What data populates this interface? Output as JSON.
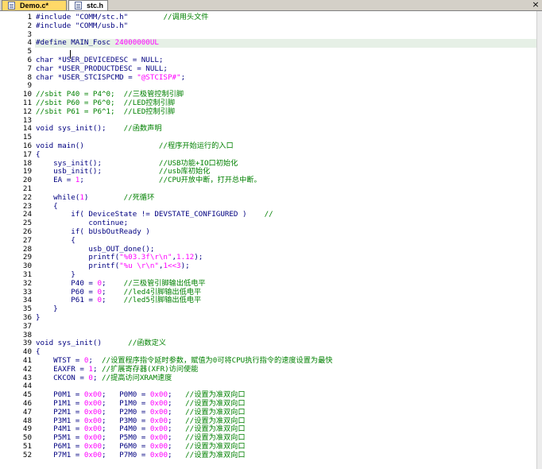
{
  "tabs": [
    {
      "label": "Demo.c*",
      "active": false
    },
    {
      "label": "stc.h",
      "active": true
    }
  ],
  "close_glyph": "×",
  "lines": [
    {
      "n": "1",
      "parts": [
        [
          "t",
          "#include \"COMM/stc.h\""
        ],
        [
          "s",
          "        "
        ],
        [
          "c",
          "//调用头文件"
        ]
      ]
    },
    {
      "n": "2",
      "parts": [
        [
          "t",
          "#include \"COMM/usb.h\""
        ]
      ]
    },
    {
      "n": "3",
      "parts": []
    },
    {
      "n": "4",
      "parts": [
        [
          "t",
          "#define MAIN_Fosc "
        ],
        [
          "n",
          "24000000UL"
        ]
      ]
    },
    {
      "n": "5",
      "parts": []
    },
    {
      "n": "6",
      "parts": [
        [
          "t",
          "char *USER_DEVICEDESC = NULL;"
        ]
      ]
    },
    {
      "n": "7",
      "parts": [
        [
          "t",
          "char *USER_PRODUCTDESC = NULL;"
        ]
      ]
    },
    {
      "n": "8",
      "parts": [
        [
          "t",
          "char *USER_STCISPCMD = "
        ],
        [
          "n",
          "\"@STCISP#\""
        ],
        [
          "t",
          ";"
        ]
      ]
    },
    {
      "n": "9",
      "parts": []
    },
    {
      "n": "10",
      "parts": [
        [
          "c",
          "//sbit P40 = P4^0;  //三极管控制引脚"
        ]
      ]
    },
    {
      "n": "11",
      "parts": [
        [
          "c",
          "//sbit P60 = P6^0;  //LED控制引脚"
        ]
      ]
    },
    {
      "n": "12",
      "parts": [
        [
          "c",
          "//sbit P61 = P6^1;  //LED控制引脚"
        ]
      ]
    },
    {
      "n": "13",
      "parts": []
    },
    {
      "n": "14",
      "parts": [
        [
          "t",
          "void sys_init();    "
        ],
        [
          "c",
          "//函数声明"
        ]
      ]
    },
    {
      "n": "15",
      "parts": []
    },
    {
      "n": "16",
      "parts": [
        [
          "t",
          "void main()                 "
        ],
        [
          "c",
          "//程序开始运行的入口"
        ]
      ]
    },
    {
      "n": "17",
      "parts": [
        [
          "t",
          "{"
        ]
      ]
    },
    {
      "n": "18",
      "parts": [
        [
          "t",
          "    sys_init();             "
        ],
        [
          "c",
          "//USB功能+IO口初始化"
        ]
      ]
    },
    {
      "n": "19",
      "parts": [
        [
          "t",
          "    usb_init();             "
        ],
        [
          "c",
          "//usb库初始化"
        ]
      ]
    },
    {
      "n": "20",
      "parts": [
        [
          "t",
          "    EA = "
        ],
        [
          "n",
          "1"
        ],
        [
          "t",
          ";                 "
        ],
        [
          "c",
          "//CPU开放中断，打开总中断。"
        ]
      ]
    },
    {
      "n": "21",
      "parts": []
    },
    {
      "n": "22",
      "parts": [
        [
          "t",
          "    while("
        ],
        [
          "n",
          "1"
        ],
        [
          "t",
          ")        "
        ],
        [
          "c",
          "//死循环"
        ]
      ]
    },
    {
      "n": "23",
      "parts": [
        [
          "t",
          "    {"
        ]
      ]
    },
    {
      "n": "24",
      "parts": [
        [
          "t",
          "        if( DeviceState != DEVSTATE_CONFIGURED )    "
        ],
        [
          "c",
          "//"
        ]
      ]
    },
    {
      "n": "25",
      "parts": [
        [
          "t",
          "            continue;"
        ]
      ]
    },
    {
      "n": "26",
      "parts": [
        [
          "t",
          "        if( bUsbOutReady )"
        ]
      ]
    },
    {
      "n": "27",
      "parts": [
        [
          "t",
          "        {"
        ]
      ]
    },
    {
      "n": "28",
      "parts": [
        [
          "t",
          "            usb_OUT_done();"
        ]
      ]
    },
    {
      "n": "29",
      "parts": [
        [
          "t",
          "            printf("
        ],
        [
          "n",
          "\"%03.3f\\r\\n\""
        ],
        [
          "t",
          ","
        ],
        [
          "n",
          "1.12"
        ],
        [
          "t",
          ");"
        ]
      ]
    },
    {
      "n": "30",
      "parts": [
        [
          "t",
          "            printf("
        ],
        [
          "n",
          "\"%u \\r\\n\""
        ],
        [
          "t",
          ","
        ],
        [
          "n",
          "1<<3"
        ],
        [
          "t",
          ");"
        ]
      ]
    },
    {
      "n": "31",
      "parts": [
        [
          "t",
          "        }"
        ]
      ]
    },
    {
      "n": "32",
      "parts": [
        [
          "t",
          "        P40 = "
        ],
        [
          "n",
          "0"
        ],
        [
          "t",
          ";    "
        ],
        [
          "c",
          "//三极管引脚输出低电平"
        ]
      ]
    },
    {
      "n": "33",
      "parts": [
        [
          "t",
          "        P60 = "
        ],
        [
          "n",
          "0"
        ],
        [
          "t",
          ";    "
        ],
        [
          "c",
          "//led4引脚输出低电平"
        ]
      ]
    },
    {
      "n": "34",
      "parts": [
        [
          "t",
          "        P61 = "
        ],
        [
          "n",
          "0"
        ],
        [
          "t",
          ";    "
        ],
        [
          "c",
          "//led5引脚输出低电平"
        ]
      ]
    },
    {
      "n": "35",
      "parts": [
        [
          "t",
          "    }"
        ]
      ]
    },
    {
      "n": "36",
      "parts": [
        [
          "t",
          "}"
        ]
      ]
    },
    {
      "n": "37",
      "parts": []
    },
    {
      "n": "38",
      "parts": []
    },
    {
      "n": "39",
      "parts": [
        [
          "t",
          "void sys_init()      "
        ],
        [
          "c",
          "//函数定义"
        ]
      ]
    },
    {
      "n": "40",
      "parts": [
        [
          "t",
          "{"
        ]
      ]
    },
    {
      "n": "41",
      "parts": [
        [
          "t",
          "    WTST = "
        ],
        [
          "n",
          "0"
        ],
        [
          "t",
          ";  "
        ],
        [
          "c",
          "//设置程序指令延时参数，赋值为0可将CPU执行指令的速度设置为最快"
        ]
      ]
    },
    {
      "n": "42",
      "parts": [
        [
          "t",
          "    EAXFR = "
        ],
        [
          "n",
          "1"
        ],
        [
          "t",
          "; "
        ],
        [
          "c",
          "//扩展寄存器(XFR)访问使能"
        ]
      ]
    },
    {
      "n": "43",
      "parts": [
        [
          "t",
          "    CKCON = "
        ],
        [
          "n",
          "0"
        ],
        [
          "t",
          "; "
        ],
        [
          "c",
          "//提高访问XRAM速度"
        ]
      ]
    },
    {
      "n": "44",
      "parts": []
    },
    {
      "n": "45",
      "parts": [
        [
          "t",
          "    P0M1 = "
        ],
        [
          "n",
          "0x00"
        ],
        [
          "t",
          ";   P0M0 = "
        ],
        [
          "n",
          "0x00"
        ],
        [
          "t",
          ";   "
        ],
        [
          "c",
          "//设置为准双向口"
        ]
      ]
    },
    {
      "n": "46",
      "parts": [
        [
          "t",
          "    P1M1 = "
        ],
        [
          "n",
          "0x00"
        ],
        [
          "t",
          ";   P1M0 = "
        ],
        [
          "n",
          "0x00"
        ],
        [
          "t",
          ";   "
        ],
        [
          "c",
          "//设置为准双向口"
        ]
      ]
    },
    {
      "n": "47",
      "parts": [
        [
          "t",
          "    P2M1 = "
        ],
        [
          "n",
          "0x00"
        ],
        [
          "t",
          ";   P2M0 = "
        ],
        [
          "n",
          "0x00"
        ],
        [
          "t",
          ";   "
        ],
        [
          "c",
          "//设置为准双向口"
        ]
      ]
    },
    {
      "n": "48",
      "parts": [
        [
          "t",
          "    P3M1 = "
        ],
        [
          "n",
          "0x00"
        ],
        [
          "t",
          ";   P3M0 = "
        ],
        [
          "n",
          "0x00"
        ],
        [
          "t",
          ";   "
        ],
        [
          "c",
          "//设置为准双向口"
        ]
      ]
    },
    {
      "n": "49",
      "parts": [
        [
          "t",
          "    P4M1 = "
        ],
        [
          "n",
          "0x00"
        ],
        [
          "t",
          ";   P4M0 = "
        ],
        [
          "n",
          "0x00"
        ],
        [
          "t",
          ";   "
        ],
        [
          "c",
          "//设置为准双向口"
        ]
      ]
    },
    {
      "n": "50",
      "parts": [
        [
          "t",
          "    P5M1 = "
        ],
        [
          "n",
          "0x00"
        ],
        [
          "t",
          ";   P5M0 = "
        ],
        [
          "n",
          "0x00"
        ],
        [
          "t",
          ";   "
        ],
        [
          "c",
          "//设置为准双向口"
        ]
      ]
    },
    {
      "n": "51",
      "parts": [
        [
          "t",
          "    P6M1 = "
        ],
        [
          "n",
          "0x00"
        ],
        [
          "t",
          ";   P6M0 = "
        ],
        [
          "n",
          "0x00"
        ],
        [
          "t",
          ";   "
        ],
        [
          "c",
          "//设置为准双向口"
        ]
      ]
    },
    {
      "n": "52",
      "parts": [
        [
          "t",
          "    P7M1 = "
        ],
        [
          "n",
          "0x00"
        ],
        [
          "t",
          ";   P7M0 = "
        ],
        [
          "n",
          "0x00"
        ],
        [
          "t",
          ";   "
        ],
        [
          "c",
          "//设置为准双向口"
        ]
      ]
    }
  ],
  "current_line": "4",
  "colors": {
    "code": "#000080",
    "comment": "#008000",
    "literal": "#ff00ff",
    "line_highlight": "#e6f0e6",
    "tab_inactive": "#ffd968"
  }
}
